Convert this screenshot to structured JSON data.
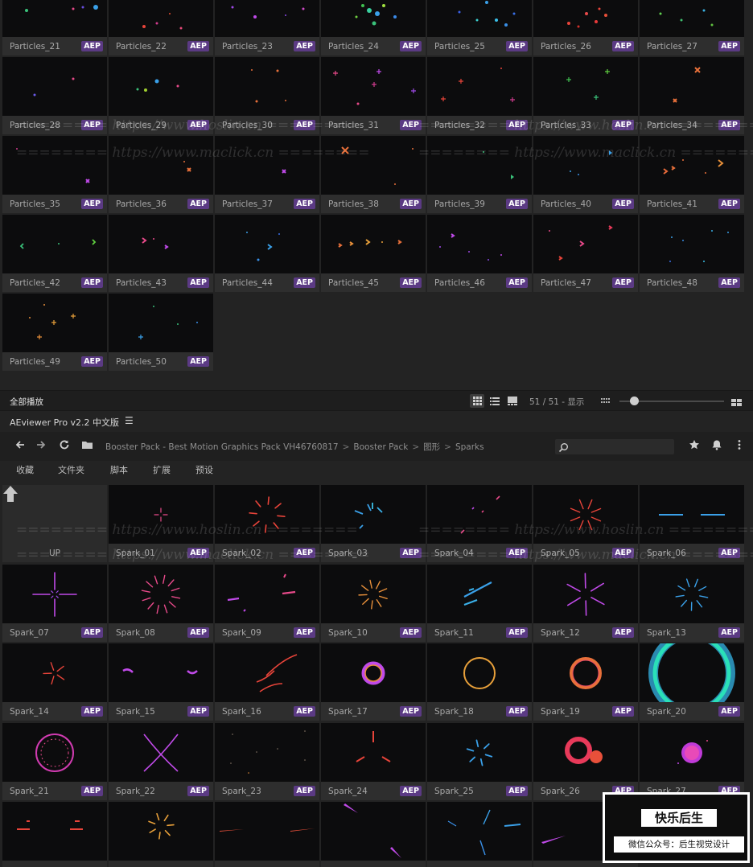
{
  "colors": {
    "accent_badge": "#5b3a84",
    "tile_bg": "#0c0c0d",
    "panel_bg": "#232323"
  },
  "upper_panel": {
    "tiles": [
      {
        "label": "Particles_21",
        "badge": "AEP"
      },
      {
        "label": "Particles_22",
        "badge": "AEP"
      },
      {
        "label": "Particles_23",
        "badge": "AEP"
      },
      {
        "label": "Particles_24",
        "badge": "AEP"
      },
      {
        "label": "Particles_25",
        "badge": "AEP"
      },
      {
        "label": "Particles_26",
        "badge": "AEP"
      },
      {
        "label": "Particles_27",
        "badge": "AEP"
      },
      {
        "label": "Particles_28",
        "badge": "AEP"
      },
      {
        "label": "Particles_29",
        "badge": "AEP"
      },
      {
        "label": "Particles_30",
        "badge": "AEP"
      },
      {
        "label": "Particles_31",
        "badge": "AEP"
      },
      {
        "label": "Particles_32",
        "badge": "AEP"
      },
      {
        "label": "Particles_33",
        "badge": "AEP"
      },
      {
        "label": "Particles_34",
        "badge": "AEP"
      },
      {
        "label": "Particles_35",
        "badge": "AEP"
      },
      {
        "label": "Particles_36",
        "badge": "AEP"
      },
      {
        "label": "Particles_37",
        "badge": "AEP"
      },
      {
        "label": "Particles_38",
        "badge": "AEP"
      },
      {
        "label": "Particles_39",
        "badge": "AEP"
      },
      {
        "label": "Particles_40",
        "badge": "AEP"
      },
      {
        "label": "Particles_41",
        "badge": "AEP"
      },
      {
        "label": "Particles_42",
        "badge": "AEP"
      },
      {
        "label": "Particles_43",
        "badge": "AEP"
      },
      {
        "label": "Particles_44",
        "badge": "AEP"
      },
      {
        "label": "Particles_45",
        "badge": "AEP"
      },
      {
        "label": "Particles_46",
        "badge": "AEP"
      },
      {
        "label": "Particles_47",
        "badge": "AEP"
      },
      {
        "label": "Particles_48",
        "badge": "AEP"
      },
      {
        "label": "Particles_49",
        "badge": "AEP"
      },
      {
        "label": "Particles_50",
        "badge": "AEP"
      }
    ],
    "status": {
      "play_all_label": "全部播放",
      "count_display": "51 / 51 - 显示",
      "view_modes": [
        "grid-view-icon",
        "list-view-icon",
        "preview-view-icon"
      ],
      "thumbnail_size_fraction": 0.14
    }
  },
  "lower_panel": {
    "app_title": "AEviewer Pro v2.2 中文版",
    "breadcrumb": [
      "Booster Pack - Best Motion Graphics Pack VH46760817",
      "Booster Pack",
      "图形",
      "Sparks"
    ],
    "search": {
      "placeholder": "",
      "value": ""
    },
    "tabs": [
      "收藏",
      "文件夹",
      "脚本",
      "扩展",
      "预设"
    ],
    "up_label": "UP",
    "tiles": [
      {
        "label": "Spark_01",
        "badge": "AEP"
      },
      {
        "label": "Spark_02",
        "badge": "AEP"
      },
      {
        "label": "Spark_03",
        "badge": "AEP"
      },
      {
        "label": "Spark_04",
        "badge": "AEP"
      },
      {
        "label": "Spark_05",
        "badge": "AEP"
      },
      {
        "label": "Spark_06",
        "badge": "AEP"
      },
      {
        "label": "Spark_07",
        "badge": "AEP"
      },
      {
        "label": "Spark_08",
        "badge": "AEP"
      },
      {
        "label": "Spark_09",
        "badge": "AEP"
      },
      {
        "label": "Spark_10",
        "badge": "AEP"
      },
      {
        "label": "Spark_11",
        "badge": "AEP"
      },
      {
        "label": "Spark_12",
        "badge": "AEP"
      },
      {
        "label": "Spark_13",
        "badge": "AEP"
      },
      {
        "label": "Spark_14",
        "badge": "AEP"
      },
      {
        "label": "Spark_15",
        "badge": "AEP"
      },
      {
        "label": "Spark_16",
        "badge": "AEP"
      },
      {
        "label": "Spark_17",
        "badge": "AEP"
      },
      {
        "label": "Spark_18",
        "badge": "AEP"
      },
      {
        "label": "Spark_19",
        "badge": "AEP"
      },
      {
        "label": "Spark_20",
        "badge": "AEP"
      },
      {
        "label": "Spark_21",
        "badge": "AEP"
      },
      {
        "label": "Spark_22",
        "badge": "AEP"
      },
      {
        "label": "Spark_23",
        "badge": "AEP"
      },
      {
        "label": "Spark_24",
        "badge": "AEP"
      },
      {
        "label": "Spark_25",
        "badge": "AEP"
      },
      {
        "label": "Spark_26",
        "badge": "AEP"
      },
      {
        "label": "Spark_27",
        "badge": "AEP"
      },
      {
        "label": "",
        "badge": ""
      },
      {
        "label": "",
        "badge": ""
      },
      {
        "label": "",
        "badge": ""
      },
      {
        "label": "",
        "badge": ""
      },
      {
        "label": "",
        "badge": ""
      },
      {
        "label": "",
        "badge": ""
      }
    ]
  },
  "watermarks": {
    "maclick": "======== https://www.maclick.cn ========",
    "hoslin": "======== https://www.hoslin.cn ========"
  },
  "promo": {
    "title": "快乐后生",
    "subtitle": "微信公众号：后生视觉设计"
  }
}
